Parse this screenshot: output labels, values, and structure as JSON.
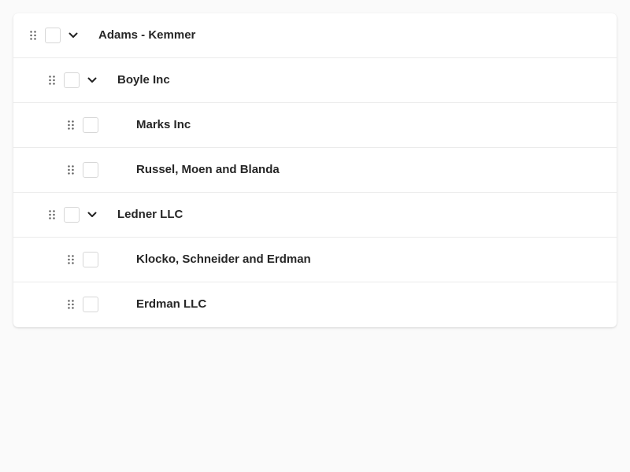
{
  "tree": {
    "rows": [
      {
        "label": "Adams - Kemmer",
        "depth": 0,
        "expandable": true,
        "expanded": true,
        "checked": false
      },
      {
        "label": "Boyle Inc",
        "depth": 1,
        "expandable": true,
        "expanded": true,
        "checked": false
      },
      {
        "label": "Marks Inc",
        "depth": 2,
        "expandable": false,
        "checked": false
      },
      {
        "label": "Russel, Moen and Blanda",
        "depth": 2,
        "expandable": false,
        "checked": false
      },
      {
        "label": "Ledner LLC",
        "depth": 1,
        "expandable": true,
        "expanded": true,
        "checked": false
      },
      {
        "label": "Klocko, Schneider and Erdman",
        "depth": 2,
        "expandable": false,
        "checked": false
      },
      {
        "label": "Erdman LLC",
        "depth": 2,
        "expandable": false,
        "checked": false
      }
    ]
  },
  "icons": {
    "drag": "drag-handle-icon",
    "toggle": "chevron-down-icon"
  },
  "colors": {
    "background": "#fafafa",
    "card": "#ffffff",
    "text": "#262626",
    "divider": "#ebebeb",
    "checkbox_border": "#d7d7d7"
  }
}
